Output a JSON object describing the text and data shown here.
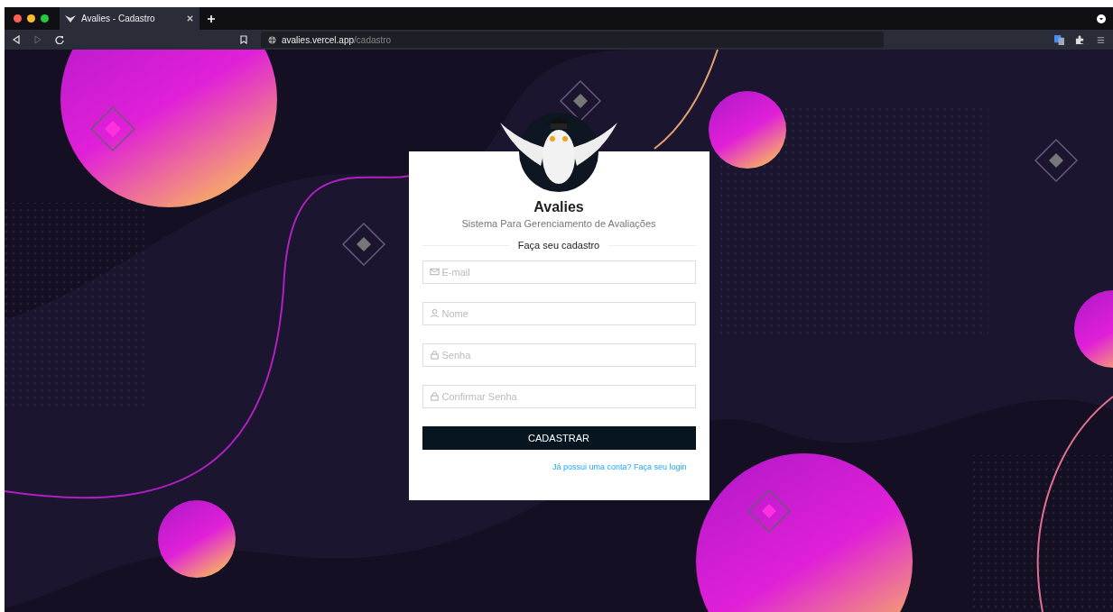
{
  "browser": {
    "tab": {
      "title": "Avalies - Cadastro",
      "selected": true
    },
    "url_host": "avalies.vercel.app",
    "url_path": "/cadastro"
  },
  "card": {
    "title": "Avalies",
    "subtitle": "Sistema Para Gerenciamento de Avaliações",
    "section": "Faça seu cadastro",
    "fields": [
      {
        "kind": "email",
        "placeholder": "E-mail"
      },
      {
        "kind": "user",
        "placeholder": "Nome"
      },
      {
        "kind": "lock",
        "placeholder": "Senha"
      },
      {
        "kind": "lock",
        "placeholder": "Confirmar Senha"
      }
    ],
    "button": "CADASTRAR",
    "link": "Já possui uma conta? Faça seu login"
  }
}
